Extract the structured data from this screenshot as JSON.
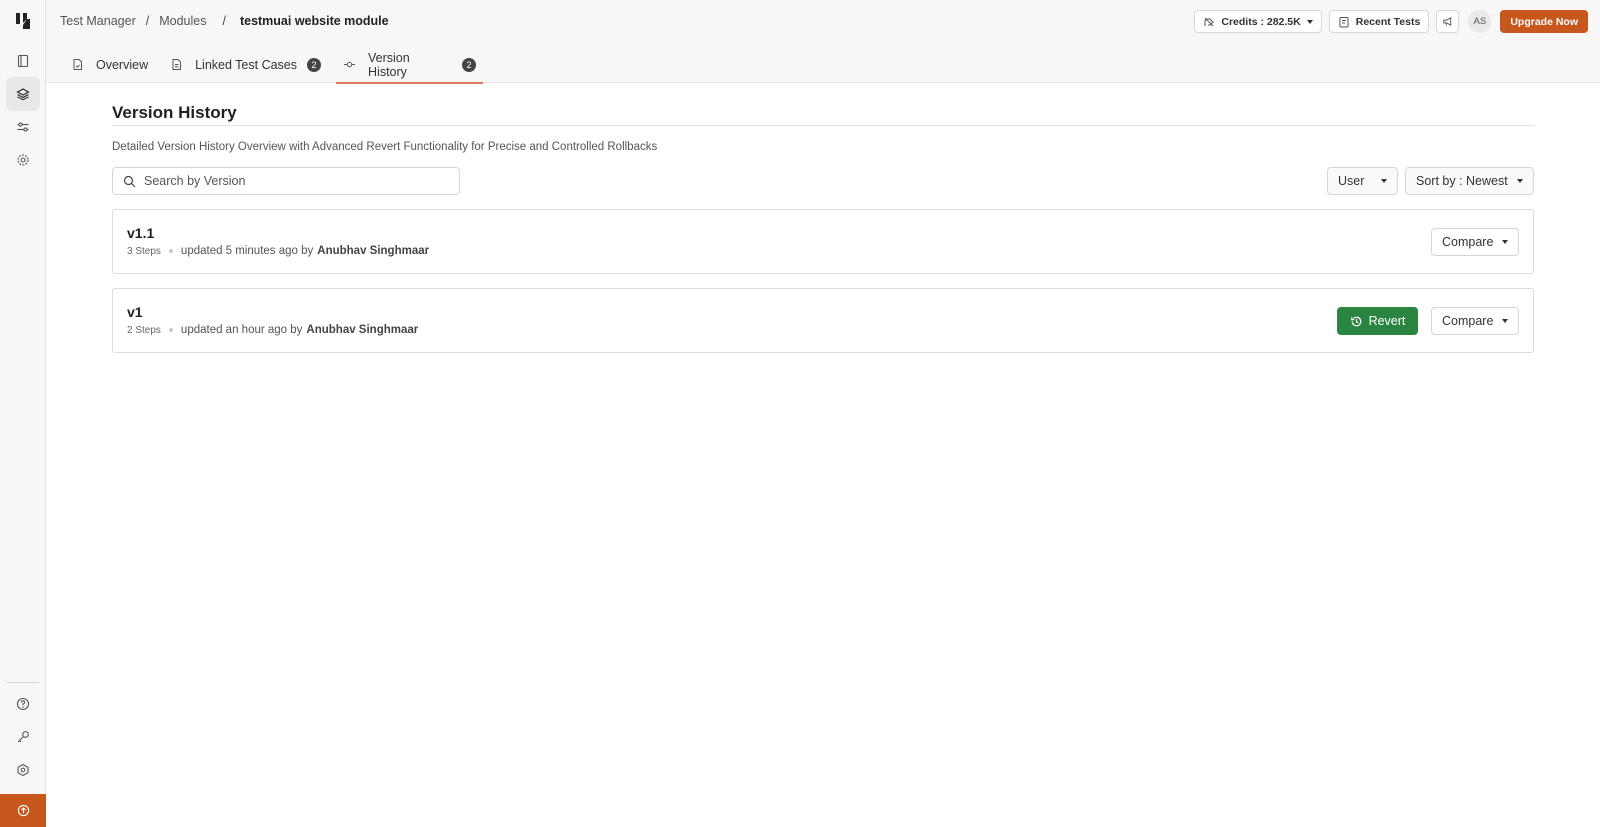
{
  "breadcrumb": {
    "items": [
      "Test Manager",
      "Modules"
    ],
    "current": "testmuai website module"
  },
  "header": {
    "credits_label": "Credits : 282.5K",
    "recent_tests_label": "Recent Tests",
    "avatar_initials": "AS",
    "upgrade_label": "Upgrade Now"
  },
  "tabs": [
    {
      "label": "Overview"
    },
    {
      "label": "Linked Test Cases",
      "count": "2"
    },
    {
      "label": "Version History",
      "count": "2",
      "active": true
    }
  ],
  "page": {
    "title": "Version History",
    "subtitle": "Detailed Version History Overview with Advanced Revert Functionality for Precise and Controlled Rollbacks"
  },
  "filters": {
    "search_placeholder": "Search by Version",
    "user_label": "User",
    "sort_label": "Sort by : Newest"
  },
  "versions": [
    {
      "version": "v1.1",
      "steps": "3 Steps",
      "updated": "updated 5 minutes ago by",
      "author": "Anubhav Singhmaar",
      "compare_label": "Compare"
    },
    {
      "version": "v1",
      "steps": "2 Steps",
      "updated": "updated an hour ago by",
      "author": "Anubhav Singhmaar",
      "compare_label": "Compare",
      "revert_label": "Revert"
    }
  ],
  "colors": {
    "accent": "#c8571e",
    "revert": "#2a8540",
    "active_tab_underline": "#e0795a"
  },
  "icons": {
    "sidebar_top": [
      "book-icon",
      "layers-icon",
      "sliders-icon",
      "gear-icon"
    ],
    "sidebar_bottom": [
      "help-icon",
      "key-icon",
      "settings-hex-icon",
      "upgrade-circle-icon"
    ]
  }
}
